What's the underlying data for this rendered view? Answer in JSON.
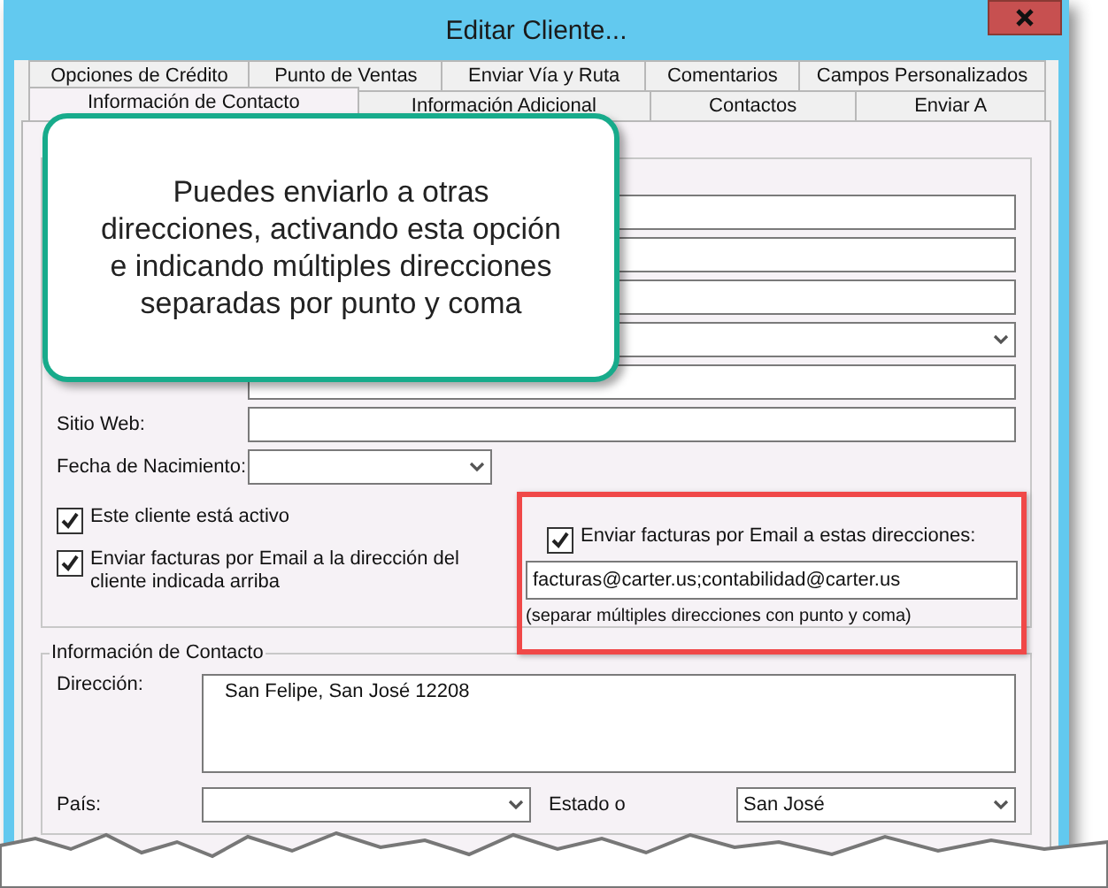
{
  "window": {
    "title": "Editar Cliente..."
  },
  "tab_rows": [
    {
      "tabs": [
        {
          "label": "Opciones de Crédito",
          "selected": false
        },
        {
          "label": "Punto de Ventas",
          "selected": false
        },
        {
          "label": "Enviar Vía y Ruta",
          "selected": false
        },
        {
          "label": "Comentarios",
          "selected": false
        },
        {
          "label": "Campos Personalizados",
          "selected": false
        }
      ]
    },
    {
      "tabs": [
        {
          "label": "Información de Contacto",
          "selected": true
        },
        {
          "label": "Información Adicional",
          "selected": false
        },
        {
          "label": "Contactos",
          "selected": false
        },
        {
          "label": "Enviar A",
          "selected": false
        }
      ]
    }
  ],
  "callout": {
    "text": "Puedes enviarlo a otras\ndirecciones, activando esta opción\ne indicando múltiples direcciones\nseparadas por punto y coma"
  },
  "fields": [
    {
      "kind": "text"
    },
    {
      "kind": "text"
    },
    {
      "kind": "text"
    },
    {
      "kind": "dropdown"
    },
    {
      "kind": "text"
    },
    {
      "kind": "text",
      "label": "Sitio Web:"
    },
    {
      "kind": "date",
      "label": "Fecha de Nacimiento:"
    }
  ],
  "checkboxes": [
    {
      "label": "Este cliente está activo",
      "checked": true
    },
    {
      "label": "Enviar facturas por Email a la dirección del cliente indicada arriba",
      "checked": true
    }
  ],
  "email_section": {
    "checkbox": {
      "label": "Enviar facturas por Email a estas direcciones:",
      "checked": true
    },
    "value": "facturas@carter.us;contabilidad@carter.us",
    "hint": "(separar múltiples direcciones con punto y coma)"
  },
  "contact_group": {
    "title": "Información de Contacto",
    "address": {
      "label": "Dirección:",
      "value": "San Felipe, San José 12208"
    },
    "country": {
      "label": "País:"
    },
    "state": {
      "label": "Estado o",
      "value": "San José"
    }
  }
}
